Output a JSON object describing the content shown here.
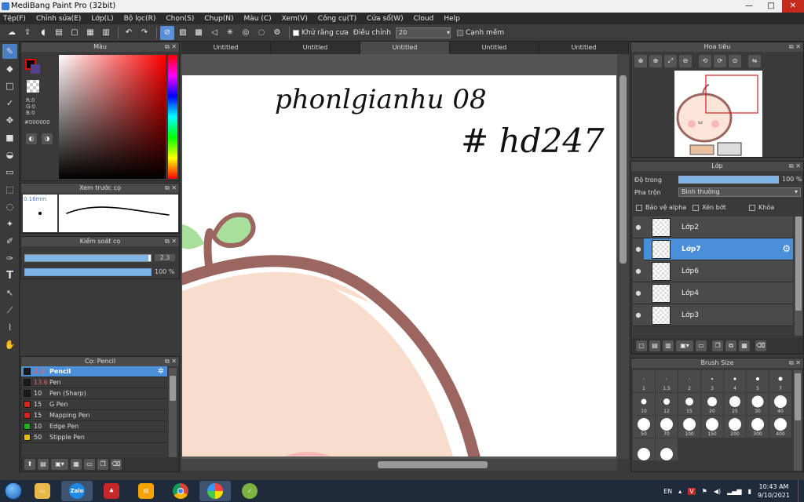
{
  "window": {
    "title": "MediBang Paint Pro (32bit)",
    "minimize": "—",
    "maximize": "□",
    "close": "✕"
  },
  "menu": [
    "Tệp(F)",
    "Chỉnh sửa(E)",
    "Lớp(L)",
    "Bộ lọc(R)",
    "Chọn(S)",
    "Chụp(N)",
    "Màu (C)",
    "Xem(V)",
    "Công cụ(T)",
    "Cửa sổ(W)",
    "Cloud",
    "Help"
  ],
  "toolbar": {
    "antialias_label": "Khử răng cưa",
    "adjust_label": "Điều chỉnh",
    "adjust_value": "20",
    "edge_label": "Cạnh mềm"
  },
  "color_panel": {
    "title": "Màu",
    "r": "R:0",
    "g": "G:0",
    "b": "B:0",
    "hex": "#000000",
    "fg": "#000000",
    "bg": "#55418c"
  },
  "brush_preview": {
    "title": "Xem trước cọ",
    "size": "0.16mm"
  },
  "brush_control": {
    "title": "Kiểm soát cọ",
    "size_value": "2.3",
    "size_fraction": 0.98,
    "opacity_value": "100 %",
    "opacity_fraction": 1.0
  },
  "brush_list": {
    "title": "Cọ: Pencil",
    "items": [
      {
        "size": "2.3",
        "name": "Pencil",
        "color": "#1a1a1a"
      },
      {
        "size": "13.6",
        "name": "Pen",
        "color": "#1a1a1a"
      },
      {
        "size": "10",
        "name": "Pen (Sharp)",
        "color": "#1a1a1a"
      },
      {
        "size": "15",
        "name": "G Pen",
        "color": "#e02020"
      },
      {
        "size": "15",
        "name": "Mapping Pen",
        "color": "#e02020"
      },
      {
        "size": "10",
        "name": "Edge Pen",
        "color": "#20b020"
      },
      {
        "size": "50",
        "name": "Stipple Pen",
        "color": "#e0c000"
      }
    ]
  },
  "tabs": [
    "Untitled",
    "Untitled",
    "Untitled",
    "Untitled",
    "Untitled"
  ],
  "active_tab": 2,
  "navigator": {
    "title": "Hoa tiêu"
  },
  "layer_panel": {
    "title": "Lớp",
    "opacity_label": "Độ trong",
    "opacity_value": "100 %",
    "blend_label": "Pha trộn",
    "blend_value": "Bình thường",
    "protect_alpha": "Bảo vệ alpha",
    "clip": "Xén bớt",
    "lock": "Khóa",
    "layers": [
      {
        "name": "Lớp2"
      },
      {
        "name": "Lớp7"
      },
      {
        "name": "Lớp6"
      },
      {
        "name": "Lớp4"
      },
      {
        "name": "Lớp3"
      }
    ],
    "selected_index": 1
  },
  "brush_size": {
    "title": "Brush Size",
    "sizes": [
      "1",
      "1.5",
      "2",
      "3",
      "4",
      "5",
      "7",
      "10",
      "12",
      "15",
      "20",
      "25",
      "30",
      "40",
      "50",
      "70",
      "100",
      "150",
      "200",
      "300",
      "400",
      "",
      ""
    ]
  },
  "canvas_text": {
    "line1": "phonlgianhu 08",
    "line2": "# hd247"
  },
  "taskbar": {
    "lang": "EN",
    "time": "10:43 AM",
    "date": "9/10/2021",
    "apps": [
      "explorer",
      "Zalo",
      "game",
      "notes",
      "chrome",
      "paint",
      "medibang"
    ]
  }
}
